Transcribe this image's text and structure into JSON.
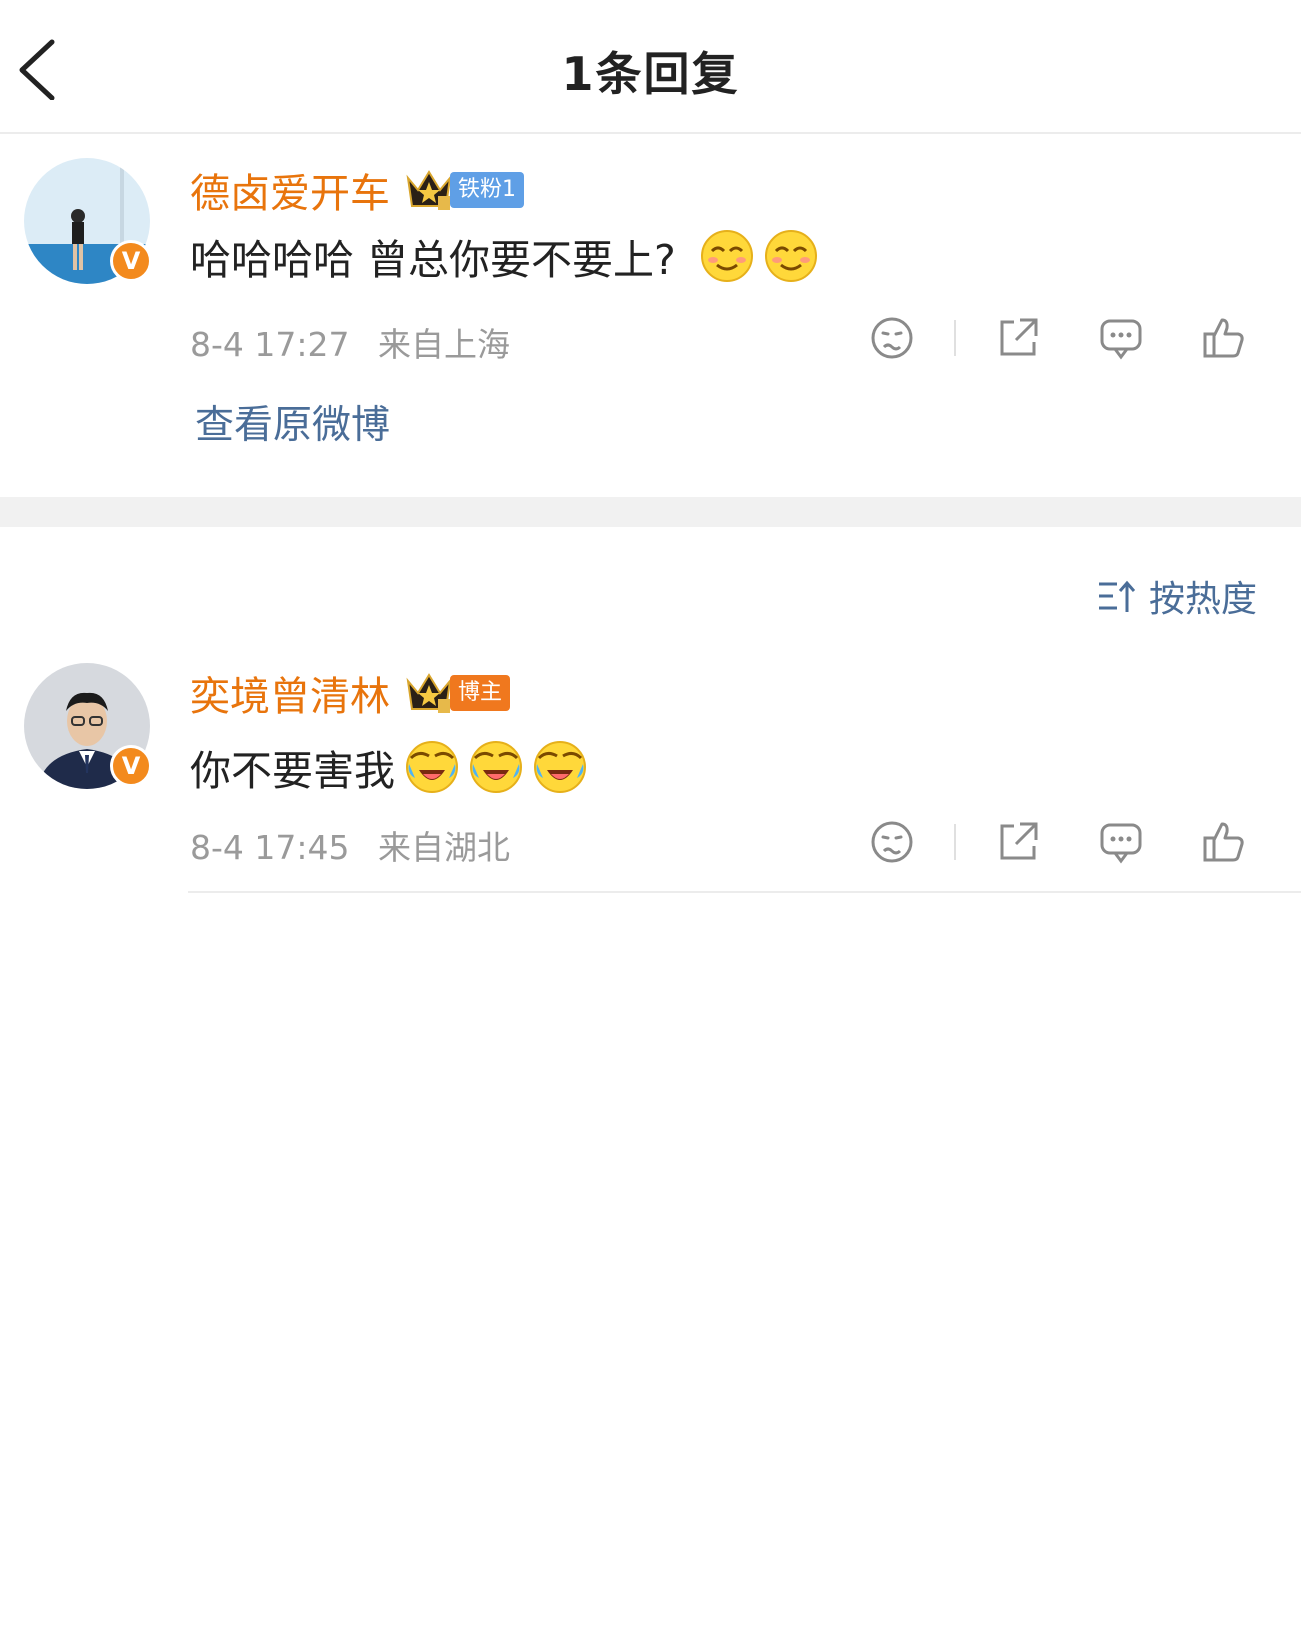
{
  "header": {
    "title": "1条回复"
  },
  "comments": [
    {
      "username": "德卤爱开车",
      "badge": "铁粉1",
      "badge_color": "#5f9fe6",
      "text": "哈哈哈哈 曾总你要不要上?",
      "emojis": [
        "smile-emoji",
        "smile-emoji"
      ],
      "time": "8-4 17:27",
      "location": "来自上海",
      "view_original": "查看原微博"
    },
    {
      "username": "奕境曾清林",
      "badge": "博主",
      "badge_color": "#f0781e",
      "text": "你不要害我",
      "emojis": [
        "laugh-cry-emoji",
        "laugh-cry-emoji",
        "laugh-cry-emoji"
      ],
      "time": "8-4 17:45",
      "location": "来自湖北"
    }
  ],
  "sort": {
    "label": "按热度"
  },
  "verified_badge": "V",
  "colors": {
    "username": "#e8740c",
    "link": "#4a6d98",
    "meta": "#9a9a9a",
    "verified": "#f38a1d"
  }
}
